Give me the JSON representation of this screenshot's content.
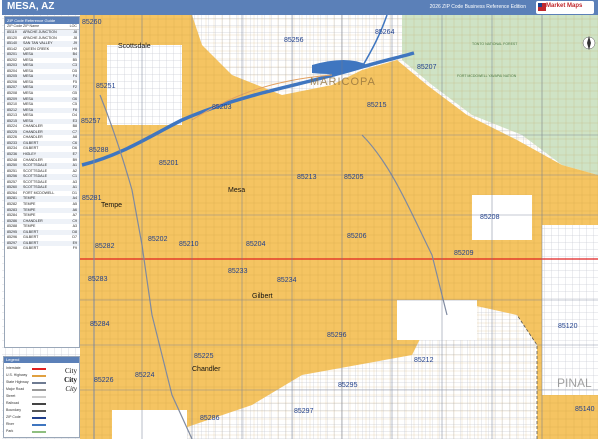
{
  "header": {
    "title": "MESA, AZ",
    "subtitle": "2026 ZIP Code Business Reference Edition",
    "logo_text": "Market Maps"
  },
  "colors": {
    "header_bg": "#5b80b8",
    "urban": "#f5c462",
    "land": "#ffffff",
    "forest": "#cfe3c5",
    "water": "#3f76c0",
    "highway": "#e02020",
    "zip_label": "#1f3f8c"
  },
  "zip_table": {
    "title": "ZIP Code Reference Guide",
    "columns": [
      "ZIP Code",
      "ZIP Name",
      "LOC"
    ],
    "rows": [
      [
        "85119",
        "APACHE JUNCTION",
        "J8"
      ],
      [
        "85120",
        "APACHE JUNCTION",
        "J8"
      ],
      [
        "85140",
        "SAN TAN VALLEY",
        "J9"
      ],
      [
        "85142",
        "QUEEN CREEK",
        "H9"
      ],
      [
        "85201",
        "MESA",
        "B4"
      ],
      [
        "85202",
        "MESA",
        "B5"
      ],
      [
        "85203",
        "MESA",
        "C3"
      ],
      [
        "85204",
        "MESA",
        "D5"
      ],
      [
        "85205",
        "MESA",
        "F4"
      ],
      [
        "85206",
        "MESA",
        "F5"
      ],
      [
        "85207",
        "MESA",
        "F2"
      ],
      [
        "85208",
        "MESA",
        "G5"
      ],
      [
        "85209",
        "MESA",
        "G6"
      ],
      [
        "85210",
        "MESA",
        "C5"
      ],
      [
        "85212",
        "MESA",
        "F8"
      ],
      [
        "85213",
        "MESA",
        "D4"
      ],
      [
        "85215",
        "MESA",
        "E3"
      ],
      [
        "85224",
        "CHANDLER",
        "B8"
      ],
      [
        "85225",
        "CHANDLER",
        "C7"
      ],
      [
        "85226",
        "CHANDLER",
        "A8"
      ],
      [
        "85233",
        "GILBERT",
        "C6"
      ],
      [
        "85234",
        "GILBERT",
        "D6"
      ],
      [
        "85236",
        "HIGLEY",
        "E7"
      ],
      [
        "85248",
        "CHANDLER",
        "B9"
      ],
      [
        "85250",
        "SCOTTSDALE",
        "A1"
      ],
      [
        "85251",
        "SCOTTSDALE",
        "A2"
      ],
      [
        "85256",
        "SCOTTSDALE",
        "C1"
      ],
      [
        "85257",
        "SCOTTSDALE",
        "A3"
      ],
      [
        "85260",
        "SCOTTSDALE",
        "A1"
      ],
      [
        "85264",
        "FORT MCDOWELL",
        "D1"
      ],
      [
        "85281",
        "TEMPE",
        "A4"
      ],
      [
        "85282",
        "TEMPE",
        "A5"
      ],
      [
        "85283",
        "TEMPE",
        "A6"
      ],
      [
        "85284",
        "TEMPE",
        "A7"
      ],
      [
        "85286",
        "CHANDLER",
        "C9"
      ],
      [
        "85288",
        "TEMPE",
        "A3"
      ],
      [
        "85295",
        "GILBERT",
        "D8"
      ],
      [
        "85296",
        "GILBERT",
        "D7"
      ],
      [
        "85297",
        "GILBERT",
        "E9"
      ],
      [
        "85298",
        "GILBERT",
        "F9"
      ]
    ]
  },
  "legend": {
    "title": "Legend",
    "items": [
      "Interstate",
      "U.S. Highway",
      "State Highway",
      "Major Road",
      "Street",
      "Railroad",
      "Boundary",
      "ZIP Code",
      "River",
      "Park"
    ],
    "city_samples": [
      "City",
      "City",
      "City"
    ]
  },
  "map": {
    "county_labels": [
      "MARICOPA",
      "PINAL"
    ],
    "cities": [
      "Scottsdale",
      "Tempe",
      "Mesa",
      "Gilbert",
      "Chandler"
    ],
    "park_labels": [
      "TONTO NATIONAL FOREST",
      "SALT RIVER PIMA-MARICOPA INDIAN COMMUNITY",
      "FORT MCDOWELL YAVAPAI NATION"
    ],
    "zip_labels": [
      "85260",
      "85256",
      "85264",
      "85207",
      "85251",
      "85215",
      "85203",
      "85257",
      "85288",
      "85201",
      "85213",
      "85205",
      "85281",
      "85208",
      "85202",
      "85210",
      "85204",
      "85206",
      "85282",
      "85209",
      "85283",
      "85233",
      "85234",
      "85284",
      "85296",
      "85225",
      "85212",
      "85120",
      "85224",
      "85295",
      "85226",
      "85297",
      "85286",
      "85140",
      "85142",
      "85248",
      "85298",
      "85236",
      "85119"
    ]
  }
}
